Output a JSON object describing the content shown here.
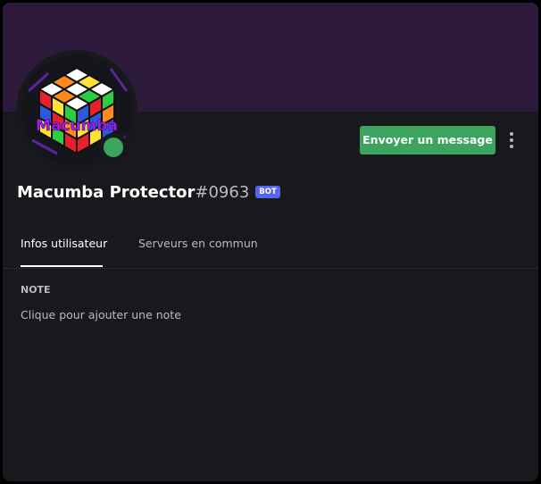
{
  "profile": {
    "username": "Macumba Protector",
    "discriminator": "#0963",
    "bot_tag": "BOT",
    "status": "online",
    "avatar_text": "Macumba"
  },
  "actions": {
    "send_message_label": "Envoyer un message",
    "more_icon": "vertical-ellipsis-icon"
  },
  "tabs": [
    {
      "label": "Infos utilisateur",
      "active": true
    },
    {
      "label": "Serveurs en commun",
      "active": false
    }
  ],
  "note": {
    "heading": "NOTE",
    "placeholder": "Clique pour ajouter une note"
  },
  "colors": {
    "banner": "#2d1a3c",
    "background": "#18191c",
    "accent_green": "#3ba55d",
    "bot_tag": "#5865f2",
    "text_primary": "#ffffff",
    "text_muted": "#b9bbbe"
  }
}
